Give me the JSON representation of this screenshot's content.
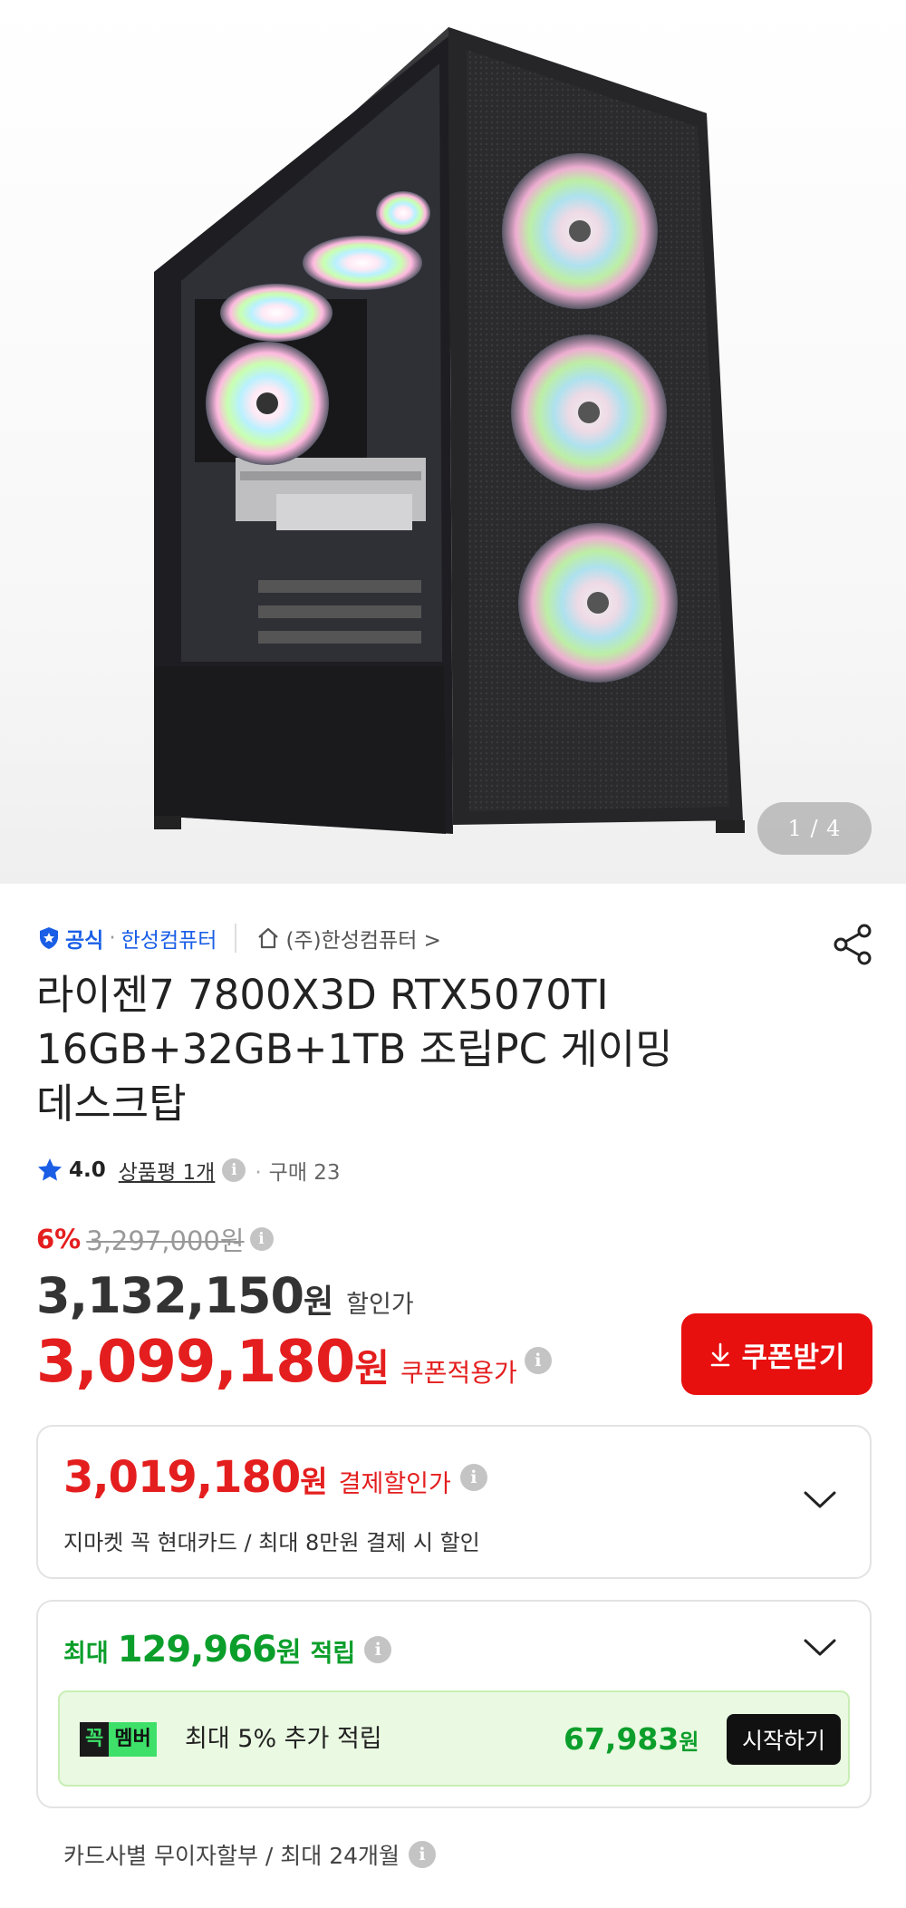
{
  "gallery": {
    "counter": "1 / 4"
  },
  "seller": {
    "official_label": "공식",
    "dot": "·",
    "brand": "한성컴퓨터",
    "store": "(주)한성컴퓨터 >"
  },
  "product": {
    "title_line1": "라이젠7 7800X3D RTX5070TI",
    "title_line2": "16GB+32GB+1TB 조립PC 게이밍",
    "title_line3": "데스크탑"
  },
  "rating": {
    "score": "4.0",
    "review_link": "상품평 1개",
    "purchase_label": "구매 23",
    "sep": "·",
    "info": "i"
  },
  "price": {
    "discount_rate": "6%",
    "original": "3,297,000원",
    "sale_price": "3,132,150",
    "sale_currency": "원",
    "sale_label": "할인가",
    "coupon_price": "3,099,180",
    "coupon_currency": "원",
    "coupon_label": "쿠폰적용가",
    "coupon_button": "쿠폰받기"
  },
  "payment": {
    "price": "3,019,180",
    "currency": "원",
    "label": "결제할인가",
    "description": "지마켓 꼭 현대카드  / 최대 8만원 결제 시 할인"
  },
  "points": {
    "prefix": "최대",
    "amount": "129,966",
    "currency": "원",
    "suffix": "적립",
    "member_badge_left": "꼭",
    "member_badge_right": "멤버",
    "member_text": "최대 5% 추가 적립",
    "member_amount": "67,983",
    "member_currency": "원",
    "start_button": "시작하기"
  },
  "installment": {
    "text": "카드사별 무이자할부 / 최대 24개월"
  },
  "colors": {
    "red": "#e41e1e",
    "coupon_button_bg": "#e80f0f",
    "green": "#0b9e2b",
    "blue": "#1a5ee6",
    "member_bg": "#eaf9e1"
  },
  "icons": [
    "official-shield-icon",
    "home-icon",
    "share-icon",
    "star-icon",
    "info-icon",
    "download-arrow-icon",
    "chevron-down-icon"
  ]
}
